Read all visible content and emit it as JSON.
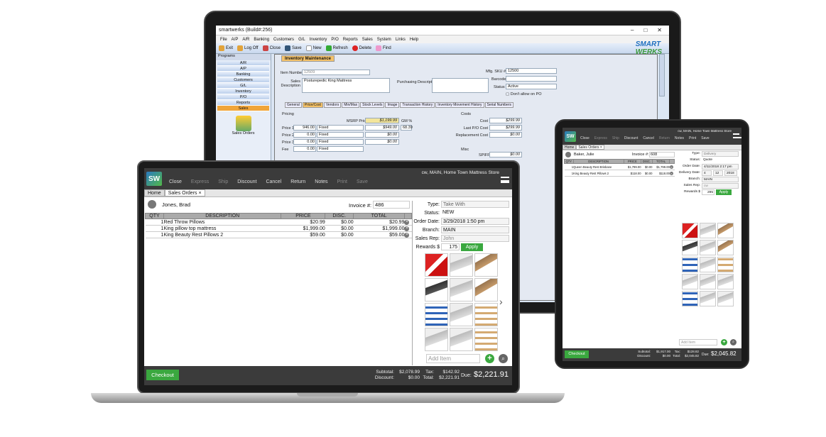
{
  "desktop": {
    "title": "smartwerks (Build#:256)",
    "menu": [
      "File",
      "A/P",
      "A/R",
      "Banking",
      "Customers",
      "G/L",
      "Inventory",
      "P/O",
      "Reports",
      "Sales",
      "System",
      "Links",
      "Help"
    ],
    "toolbar": [
      "Exit",
      "Log Off",
      "Close",
      "Save",
      "New",
      "Refresh",
      "Delete",
      "Find"
    ],
    "brand_a": "SMART",
    "brand_b": "WERKS",
    "programs_label": "Programs",
    "programs": [
      "A/R",
      "A/P",
      "Banking",
      "Customers",
      "G/L",
      "Inventory",
      "P/O",
      "Reports",
      "Sales"
    ],
    "sales_orders_label": "Sales Orders",
    "form_tab": "Inventory Maintenance",
    "item_number_label": "Item Number",
    "item_number": "12509",
    "sales_desc_label": "Sales Description",
    "sales_desc": "Posturepedic King Mattress",
    "purchasing_desc_label": "Purchasing Description",
    "mfg_sku_label": "Mfg. SKU #",
    "mfg_sku": "12500",
    "barcode_label": "Barcode",
    "status_label": "Status",
    "status": "Active",
    "dont_allow_po": "Don't allow on PO",
    "tabs": [
      "General",
      "Price/Cost",
      "Vendors",
      "Min/Max",
      "Stock Levels",
      "Image",
      "Transaction History",
      "Inventory Movement History",
      "Serial Numbers"
    ],
    "pricing_label": "Pricing",
    "msrp_label": "MSRP Price",
    "msrp": "$1,199.99",
    "gm_label": "GM %",
    "prices": [
      {
        "label": "Price 1",
        "value": "946.00",
        "type": "Fixed",
        "amt": "$949.00",
        "gm": "68.39"
      },
      {
        "label": "Price 2",
        "value": "0.00",
        "type": "Fixed",
        "amt": "$0.00",
        "gm": ""
      },
      {
        "label": "Price 3",
        "value": "0.00",
        "type": "Fixed",
        "amt": "$0.00",
        "gm": ""
      },
      {
        "label": "Fee",
        "value": "0.00",
        "type": "Fixed",
        "amt": "",
        "gm": ""
      }
    ],
    "costs_label": "Costs",
    "costs": [
      {
        "label": "Cost",
        "value": "$299.99"
      },
      {
        "label": "Last P/O Cost",
        "value": "$299.99"
      },
      {
        "label": "Replacement Cost",
        "value": "$0.00"
      }
    ],
    "misc_label": "Misc",
    "spiff_label": "SPIFF",
    "spiff": "$0.00"
  },
  "laptop": {
    "toolbar": {
      "close": "Close",
      "express": "Express",
      "ship": "Ship",
      "discount": "Discount",
      "cancel": "Cancel",
      "return": "Return",
      "notes": "Notes",
      "print": "Print",
      "save": "Save"
    },
    "store": "cw, MAIN, Home Town Mattress Store",
    "tabs": {
      "home": "Home",
      "sales_orders": "Sales Orders ×"
    },
    "customer": "Jones, Brad",
    "invoice_label": "Invoice #:",
    "invoice": "486",
    "columns": [
      "QTY",
      "DESCRIPTION",
      "PRICE",
      "DISC.",
      "TOTAL"
    ],
    "rows": [
      {
        "qty": "1",
        "desc": "Red Throw Pillows",
        "price": "$20.99",
        "disc": "$0.00",
        "total": "$20.99"
      },
      {
        "qty": "1",
        "desc": "King pillow top mattress",
        "price": "$1,999.00",
        "disc": "$0.00",
        "total": "$1,999.00"
      },
      {
        "qty": "1",
        "desc": "King Beauty Rest Pillows 2",
        "price": "$59.00",
        "disc": "$0.00",
        "total": "$59.00"
      }
    ],
    "type_label": "Type:",
    "type": "Take With",
    "status_label": "Status:",
    "status": "NEW",
    "order_date_label": "Order Date:",
    "order_date": "3/29/2018 1:50 pm",
    "branch_label": "Branch:",
    "branch": "MAIN",
    "sales_rep_label": "Sales Rep:",
    "sales_rep": "John",
    "rewards_label": "Rewards $",
    "rewards": "175",
    "apply": "Apply",
    "add_item_placeholder": "Add Item",
    "checkout": "Checkout",
    "subtotal_label": "Subtotal:",
    "subtotal": "$2,078.99",
    "discount_label": "Discount:",
    "discount": "$0.00",
    "tax_label": "Tax:",
    "tax": "$142.92",
    "total_label": "Total:",
    "total": "$2,221.91",
    "due_label": "Due:",
    "due": "$2,221.91"
  },
  "tablet": {
    "toolbar": {
      "close": "Close",
      "express": "Express",
      "ship": "Ship",
      "discount": "Discount",
      "cancel": "Cancel",
      "return": "Return",
      "notes": "Notes",
      "print": "Print",
      "save": "Save"
    },
    "store": "cw, MAIN, Home Town Mattress Store",
    "tabs": {
      "home": "Home",
      "sales_orders": "Sales Orders ×"
    },
    "customer": "Baker, Julie",
    "invoice_label": "Invoice #:",
    "invoice": "608",
    "columns": [
      "QTY",
      "DESCRIPTION",
      "PRICE",
      "DISC.",
      "TOTAL"
    ],
    "rows": [
      {
        "qty": "1",
        "desc": "Queen Beauty Rest Brisbane",
        "price": "$1,799.00",
        "disc": "$0.00",
        "total": "$1,799.00"
      },
      {
        "qty": "1",
        "desc": "King Beauty Rest Pillows 2",
        "price": "$118.00",
        "disc": "$0.00",
        "total": "$118.00"
      }
    ],
    "type_label": "Type:",
    "type": "Delivery",
    "status_label": "Status:",
    "status": "Quote",
    "order_date_label": "Order Date:",
    "order_date": "4/11/2018 2:17 pm",
    "delivery_date_label": "Delivery Date:",
    "delivery_month": "4",
    "delivery_day": "12",
    "delivery_year": "2018",
    "branch_label": "Branch:",
    "branch": "MAIN",
    "sales_rep_label": "Sales Rep:",
    "sales_rep": "cw",
    "rewards_label": "Rewards $",
    "rewards": "295",
    "apply": "Apply",
    "add_item_placeholder": "Add Item",
    "checkout": "Checkout",
    "subtotal_label": "Subtotal:",
    "subtotal": "$1,917.00",
    "discount_label": "Discount:",
    "discount": "$0.00",
    "tax_label": "Tax:",
    "tax": "$128.82",
    "total_label": "Total:",
    "total": "$2,045.82",
    "due_label": "Due:",
    "due": "$2,045.82"
  },
  "logo_text": "SW",
  "colors": {
    "green": "#3aa83f",
    "dark": "#3b3b3b",
    "accent": "#f0a53a",
    "blue": "#1f6fbf"
  }
}
